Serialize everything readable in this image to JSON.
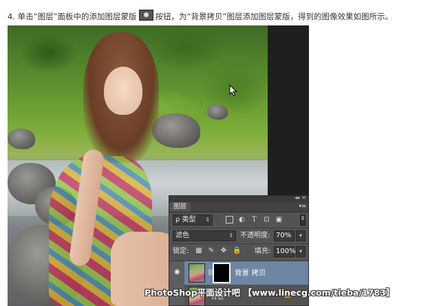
{
  "instruction": {
    "before": "4. 单击“图层”面板中的添加图层蒙版",
    "after": "按钮，为“背景拷贝”图层添加图层蒙版，得到的图像效果如图所示。",
    "button_icon": "add-layer-mask-icon"
  },
  "panel": {
    "tab_label": "图层",
    "collapse_icon": "collapse-double-arrow-icon",
    "close_icon": "close-icon",
    "menu_icon": "panel-menu-icon",
    "filter": {
      "kind_label": "ρ 类型",
      "icons": [
        "pixel-filter-icon",
        "adjustment-filter-icon",
        "type-filter-icon",
        "shape-filter-icon",
        "smart-object-filter-icon"
      ]
    },
    "blend_mode": "滤色",
    "opacity_label": "不透明度:",
    "opacity_value": "70%",
    "lock_label": "锁定:",
    "lock_icons": [
      "lock-transparent-icon",
      "lock-image-icon",
      "lock-position-icon",
      "lock-all-icon"
    ],
    "fill_label": "填充:",
    "fill_value": "100%",
    "layers": [
      {
        "name": "背景 拷贝",
        "selected": true,
        "visible": true,
        "has_mask": true
      },
      {
        "name": "背景",
        "selected": false,
        "visible": true,
        "locked": true
      }
    ]
  },
  "watermark": "PhotoShop平面设计吧 【www.linecg.com/tieba/1783】",
  "colors": {
    "panel_bg": "#535353",
    "selected_layer": "#6d86a3",
    "mask_thumb": "#000000"
  }
}
